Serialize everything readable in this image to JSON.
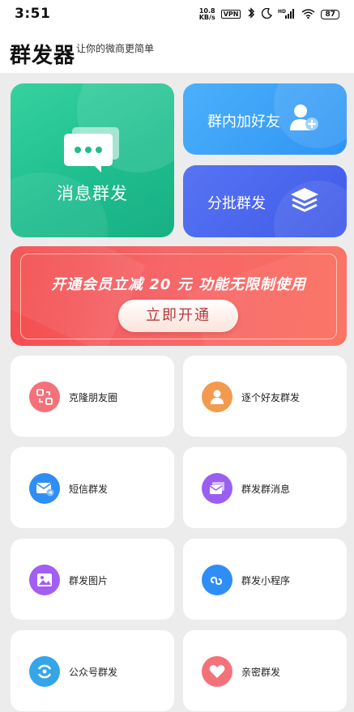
{
  "status": {
    "time": "3:51",
    "speed_top": "10.8",
    "speed_bottom": "KB/s",
    "vpn": "VPN",
    "hd": "HD",
    "battery": "87"
  },
  "header": {
    "title": "群发器",
    "subtitle": "让你的微商更简单"
  },
  "hero": {
    "mass_send": "消息群发",
    "group_add": "群内加好友",
    "batch_send": "分批群发"
  },
  "promo": {
    "text": "开通会员立减 20 元  功能无限制使用",
    "button": "立即开通"
  },
  "grid": [
    {
      "label": "克隆朋友圈",
      "icon": "clone-icon",
      "color": "#f3727a"
    },
    {
      "label": "逐个好友群发",
      "icon": "user-icon",
      "color": "#f39a4e"
    },
    {
      "label": "短信群发",
      "icon": "sms-mail-icon",
      "color": "#2f8ef5"
    },
    {
      "label": "群发群消息",
      "icon": "group-message-icon",
      "color": "#9a5ff0"
    },
    {
      "label": "群发图片",
      "icon": "image-icon",
      "color": "#a25ff0"
    },
    {
      "label": "群发小程序",
      "icon": "mini-program-icon",
      "color": "#2f8ef5"
    },
    {
      "label": "公众号群发",
      "icon": "official-account-icon",
      "color": "#34a6e8"
    },
    {
      "label": "亲密群发",
      "icon": "heart-icon",
      "color": "#f3727a"
    }
  ]
}
